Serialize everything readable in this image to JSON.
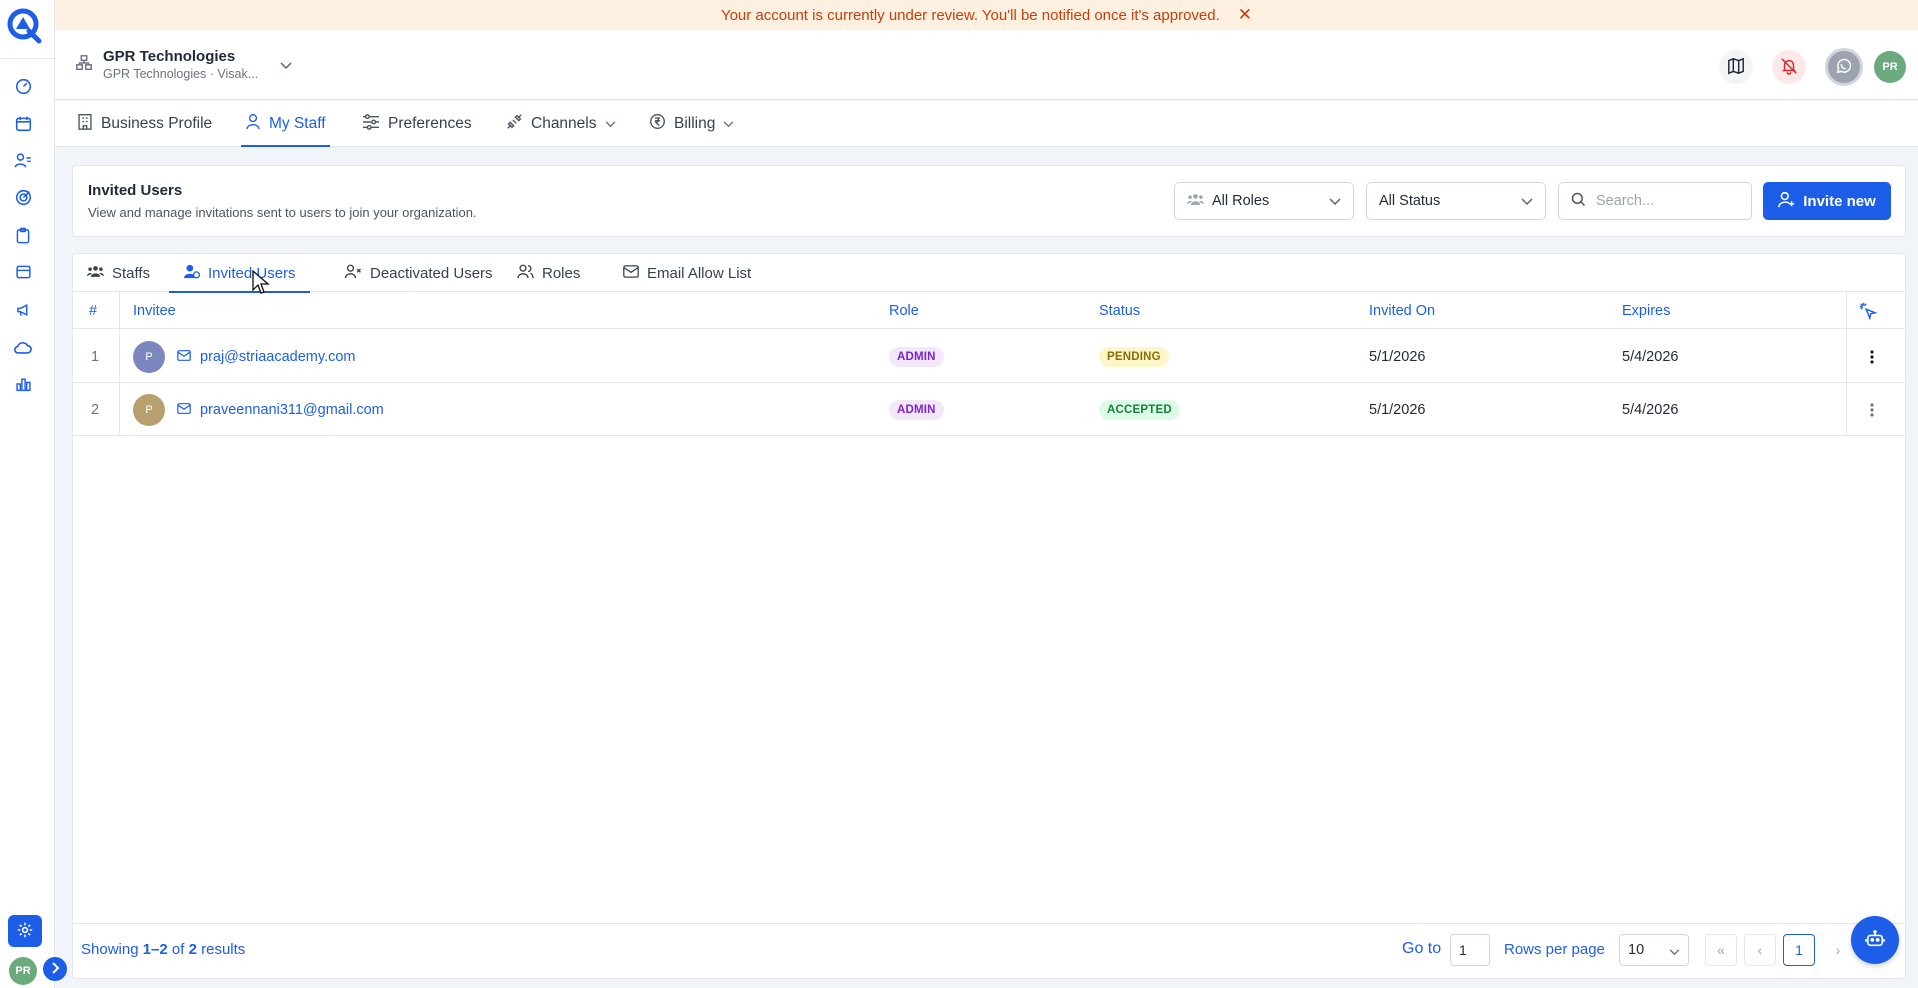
{
  "banner": {
    "message": "Your account is currently under review. You'll be notified once it's approved."
  },
  "org": {
    "name": "GPR Technologies",
    "subtitle": "GPR Technologies · Visak..."
  },
  "user": {
    "initials": "PR"
  },
  "settings_tabs": [
    "Business Profile",
    "My Staff",
    "Preferences",
    "Channels",
    "Billing"
  ],
  "section": {
    "title": "Invited Users",
    "description": "View and manage invitations sent to users to join your organization."
  },
  "filters": {
    "roles": "All Roles",
    "status": "All Status",
    "search_placeholder": "Search...",
    "invite_label": "Invite new"
  },
  "user_tabs": [
    "Staffs",
    "Invited Users",
    "Deactivated Users",
    "Roles",
    "Email Allow List"
  ],
  "table": {
    "columns": {
      "num": "#",
      "invitee": "Invitee",
      "role": "Role",
      "status": "Status",
      "invited_on": "Invited On",
      "expires": "Expires"
    },
    "rows": [
      {
        "num": "1",
        "initial": "P",
        "email": "praj@striaacademy.com",
        "role": "ADMIN",
        "status": "PENDING",
        "invited_on": "5/1/2026",
        "expires": "5/4/2026"
      },
      {
        "num": "2",
        "initial": "P",
        "email": "praveennani311@gmail.com",
        "role": "ADMIN",
        "status": "ACCEPTED",
        "invited_on": "5/1/2026",
        "expires": "5/4/2026"
      }
    ]
  },
  "footer": {
    "showing_prefix": "Showing",
    "range": "1–2",
    "of": "of",
    "total": "2",
    "suffix": "results",
    "goto_label": "Go to",
    "goto_value": "1",
    "rows_label": "Rows per page",
    "rows_value": "10",
    "current_page": "1"
  },
  "colors": {
    "accent": "#1d5ee8",
    "banner_bg": "#fdf0e0",
    "banner_text": "#c2410c"
  }
}
